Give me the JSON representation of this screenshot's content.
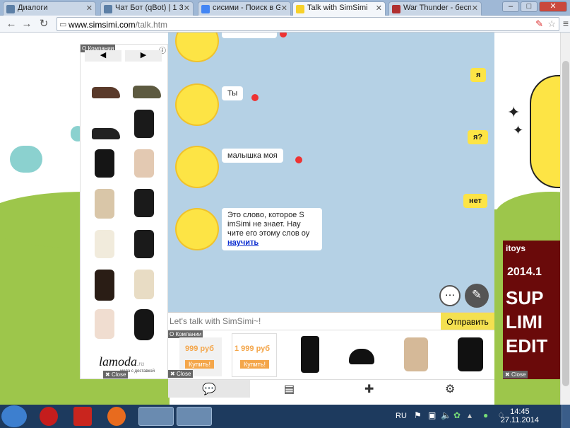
{
  "tabs": [
    {
      "label": "Диалоги",
      "color": "#5c7fa6"
    },
    {
      "label": "Чат Бот (qBot) | 1 305",
      "color": "#5c7fa6"
    },
    {
      "label": "сисими - Поиск в Goo",
      "color": "#4285f4"
    },
    {
      "label": "Talk with SimSimi",
      "color": "#f7d12a"
    },
    {
      "label": "War Thunder - беспла",
      "color": "#b03030"
    }
  ],
  "window_controls": {
    "minimize": "–",
    "maximize": "□",
    "close": "✕"
  },
  "address": {
    "host": "www.simsimi.com",
    "path": "/talk.htm"
  },
  "left_shop": {
    "label": "О Компании",
    "brand": "lamoda",
    "brand_suffix": ".ru",
    "brand_tag": "мода с доставкой",
    "close": "Close"
  },
  "chat": {
    "messages": [
      {
        "from": "user",
        "text": "я"
      },
      {
        "from": "sim",
        "text": "Ты"
      },
      {
        "from": "user",
        "text": "я?"
      },
      {
        "from": "sim",
        "text": "малышка моя"
      },
      {
        "from": "user",
        "text": "нет"
      },
      {
        "from": "sim",
        "text": "Это слово, которое S imSimi не знает. Нау чите его этому слов оу",
        "link": "научить"
      }
    ],
    "input_placeholder": "Let's talk with SimSimi~!",
    "send_label": "Отправить"
  },
  "ad_bar": {
    "label": "О Компании",
    "price1": "999 руб",
    "price2": "1 999 руб",
    "buy": "Купить!",
    "close": "Close"
  },
  "right_ad": {
    "brand": "itoys",
    "year": "2014.1",
    "line1": "SUP",
    "line2": "LIMI",
    "line3": "EDIT",
    "close": "Close"
  },
  "taskbar": {
    "lang": "RU",
    "time": "14:45",
    "date": "27.11.2014"
  },
  "icons": [
    "chat-icon",
    "notebook-icon",
    "gamepad-icon",
    "gear-icon",
    "speech-add-icon",
    "pencil-icon"
  ]
}
